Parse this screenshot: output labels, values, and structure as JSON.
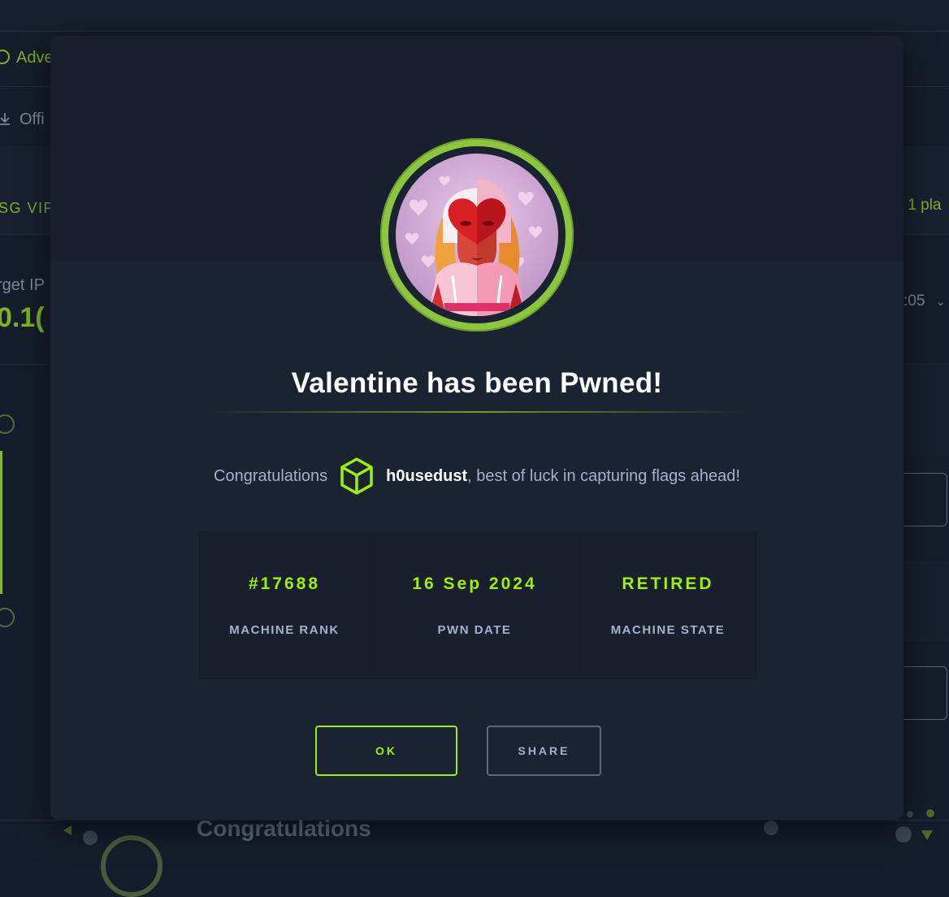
{
  "background": {
    "sidebar_item_1": "Adve",
    "sidebar_item_2": "Offi",
    "vip_label": "SG VIP",
    "players_label": "1 pla",
    "target_ip_label": "rget IP",
    "target_ip_value": "0.1(",
    "time_value": ":05",
    "congratulations_heading": "Congratulations"
  },
  "modal": {
    "title": "Valentine has been Pwned!",
    "congrats_prefix": "Congratulations",
    "username": "h0usedust",
    "congrats_suffix": ", best of luck in capturing flags ahead!",
    "stats": [
      {
        "value": "#17688",
        "label": "MACHINE RANK"
      },
      {
        "value": "16 Sep 2024",
        "label": "PWN DATE"
      },
      {
        "value": "RETIRED",
        "label": "MACHINE STATE"
      }
    ],
    "ok_label": "OK",
    "share_label": "SHARE"
  },
  "colors": {
    "accent_green": "#9fef00",
    "avatar_ring": "#8cc63f",
    "background": "#141d2b",
    "panel": "#1a2332"
  },
  "icons": {
    "user_avatar": "cube-icon",
    "machine_avatar": "valentine-heart-mask-avatar"
  }
}
